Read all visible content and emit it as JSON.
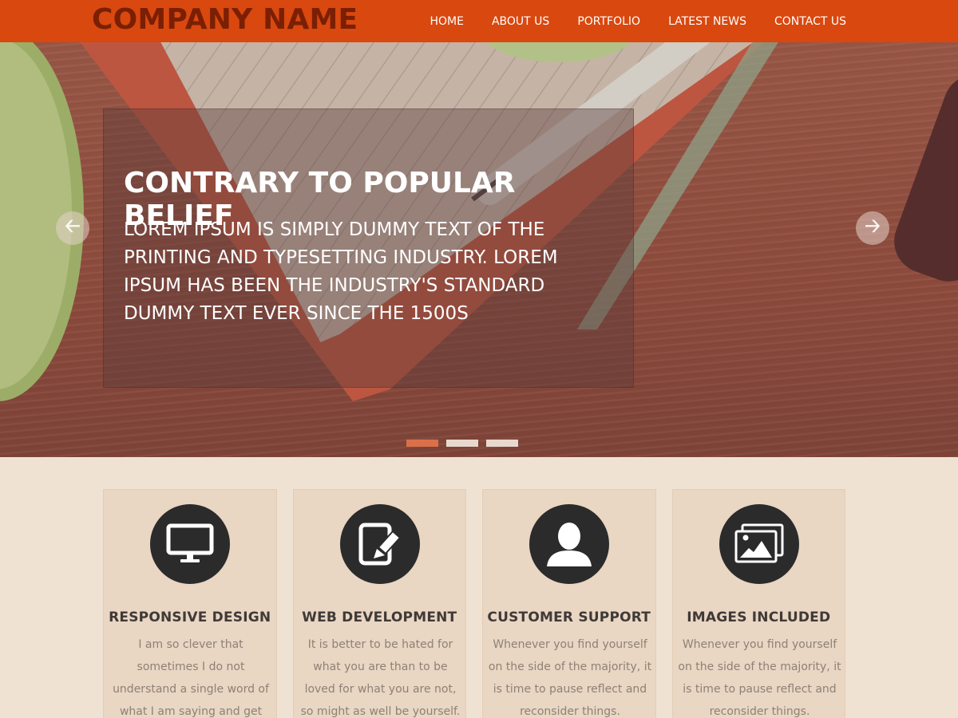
{
  "header": {
    "logo": "COMPANY NAME",
    "nav": [
      "HOME",
      "ABOUT US",
      "PORTFOLIO",
      "LATEST NEWS",
      "CONTACT US"
    ]
  },
  "hero": {
    "title": "CONTRARY TO POPULAR BELIEF",
    "text": "LOREM IPSUM IS SIMPLY DUMMY TEXT OF THE PRINTING AND TYPESETTING INDUSTRY. LOREM IPSUM HAS BEEN THE INDUSTRY'S STANDARD DUMMY TEXT EVER SINCE THE 1500S",
    "prev_icon": "arrow-left-icon",
    "next_icon": "arrow-right-icon",
    "slides": 3,
    "active_slide": 1
  },
  "features": [
    {
      "icon": "monitor-icon",
      "title": "RESPONSIVE DESIGN",
      "text": "I am so clever that sometimes I do not understand a single word of what I am saying and get very confused."
    },
    {
      "icon": "edit-tablet-icon",
      "title": "WEB DEVELOPMENT",
      "text": "It is better to be hated for what you are than to be loved for what you are not, so might as well be yourself."
    },
    {
      "icon": "user-icon",
      "title": "CUSTOMER SUPPORT",
      "text": "Whenever you find yourself on the side of the majority, it is time to pause reflect and reconsider things."
    },
    {
      "icon": "images-icon",
      "title": "IMAGES INCLUDED",
      "text": "Whenever you find yourself on the side of the majority, it is time to pause reflect and reconsider things."
    }
  ],
  "colors": {
    "header_bg": "#d9480f",
    "logo": "#7a1f04",
    "page_bg": "#efe2d3",
    "card_bg": "#e9d6c3",
    "icon_circle": "#2b2b2b",
    "active_dot": "#d9704a"
  }
}
